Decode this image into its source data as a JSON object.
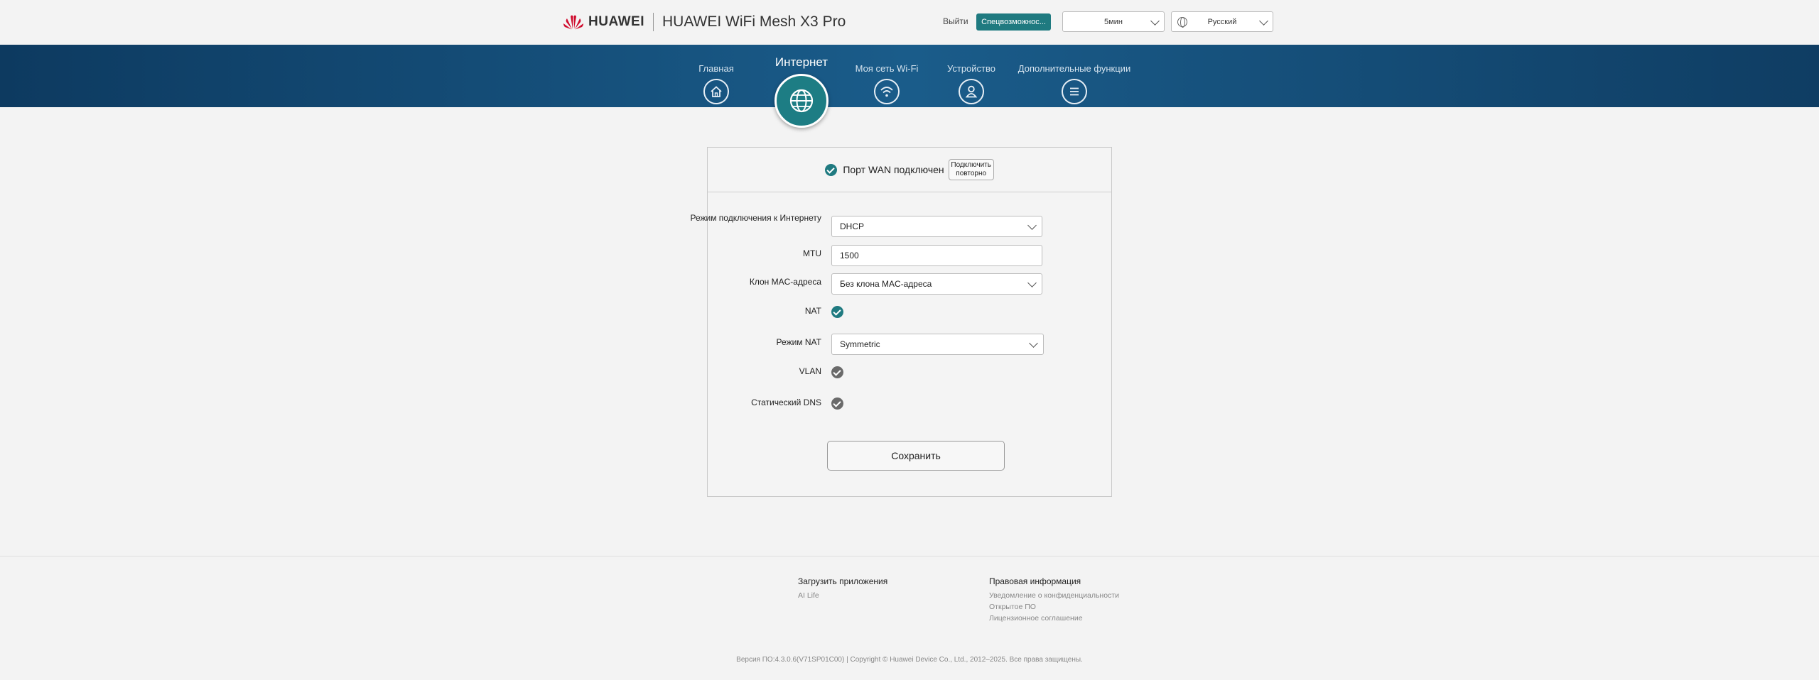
{
  "header": {
    "brand_word": "HUAWEI",
    "product_name": "HUAWEI WiFi Mesh X3 Pro",
    "logout_label": "Выйти",
    "accessibility_label": "Спецвозможнос...",
    "timeout_value": "5мин",
    "language_value": "Русский"
  },
  "nav": {
    "items": [
      {
        "label": "Главная",
        "icon": "home-icon"
      },
      {
        "label": "Интернет",
        "icon": "globe-icon"
      },
      {
        "label": "Моя сеть Wi-Fi",
        "icon": "wifi-icon"
      },
      {
        "label": "Устройство",
        "icon": "user-icon"
      },
      {
        "label": "Дополнительные функции",
        "icon": "menu-icon"
      }
    ],
    "active": "Интернет"
  },
  "wan": {
    "status_text": "Порт WAN подключен",
    "reconnect_label": "Подключить повторно"
  },
  "form": {
    "connection_mode": {
      "label": "Режим подключения к Интернету",
      "value": "DHCP"
    },
    "mtu": {
      "label": "MTU",
      "value": "1500"
    },
    "mac_clone": {
      "label": "Клон MAC-адреса",
      "value": "Без клона MAC-адреса"
    },
    "nat": {
      "label": "NAT",
      "checked": true
    },
    "nat_mode": {
      "label": "Режим NAT",
      "value": "Symmetric"
    },
    "vlan": {
      "label": "VLAN",
      "checked": true
    },
    "static_dns": {
      "label": "Статический DNS",
      "checked": true
    },
    "save_label": "Сохранить"
  },
  "footer": {
    "apps_title": "Загрузить приложения",
    "apps_link": "AI Life",
    "legal_title": "Правовая информация",
    "legal_links": [
      "Уведомление о конфиденциальности",
      "Открытое ПО",
      "Лицензионное соглашение"
    ],
    "copyright": "Версия ПО:4.3.0.6(V71SP01C00) | Copyright © Huawei Device Co., Ltd., 2012–2025. Все права защищены."
  },
  "colors": {
    "accent": "#1f7a80",
    "nav_band": "#1a5c8a",
    "huawei_red": "#cf0a2c"
  }
}
